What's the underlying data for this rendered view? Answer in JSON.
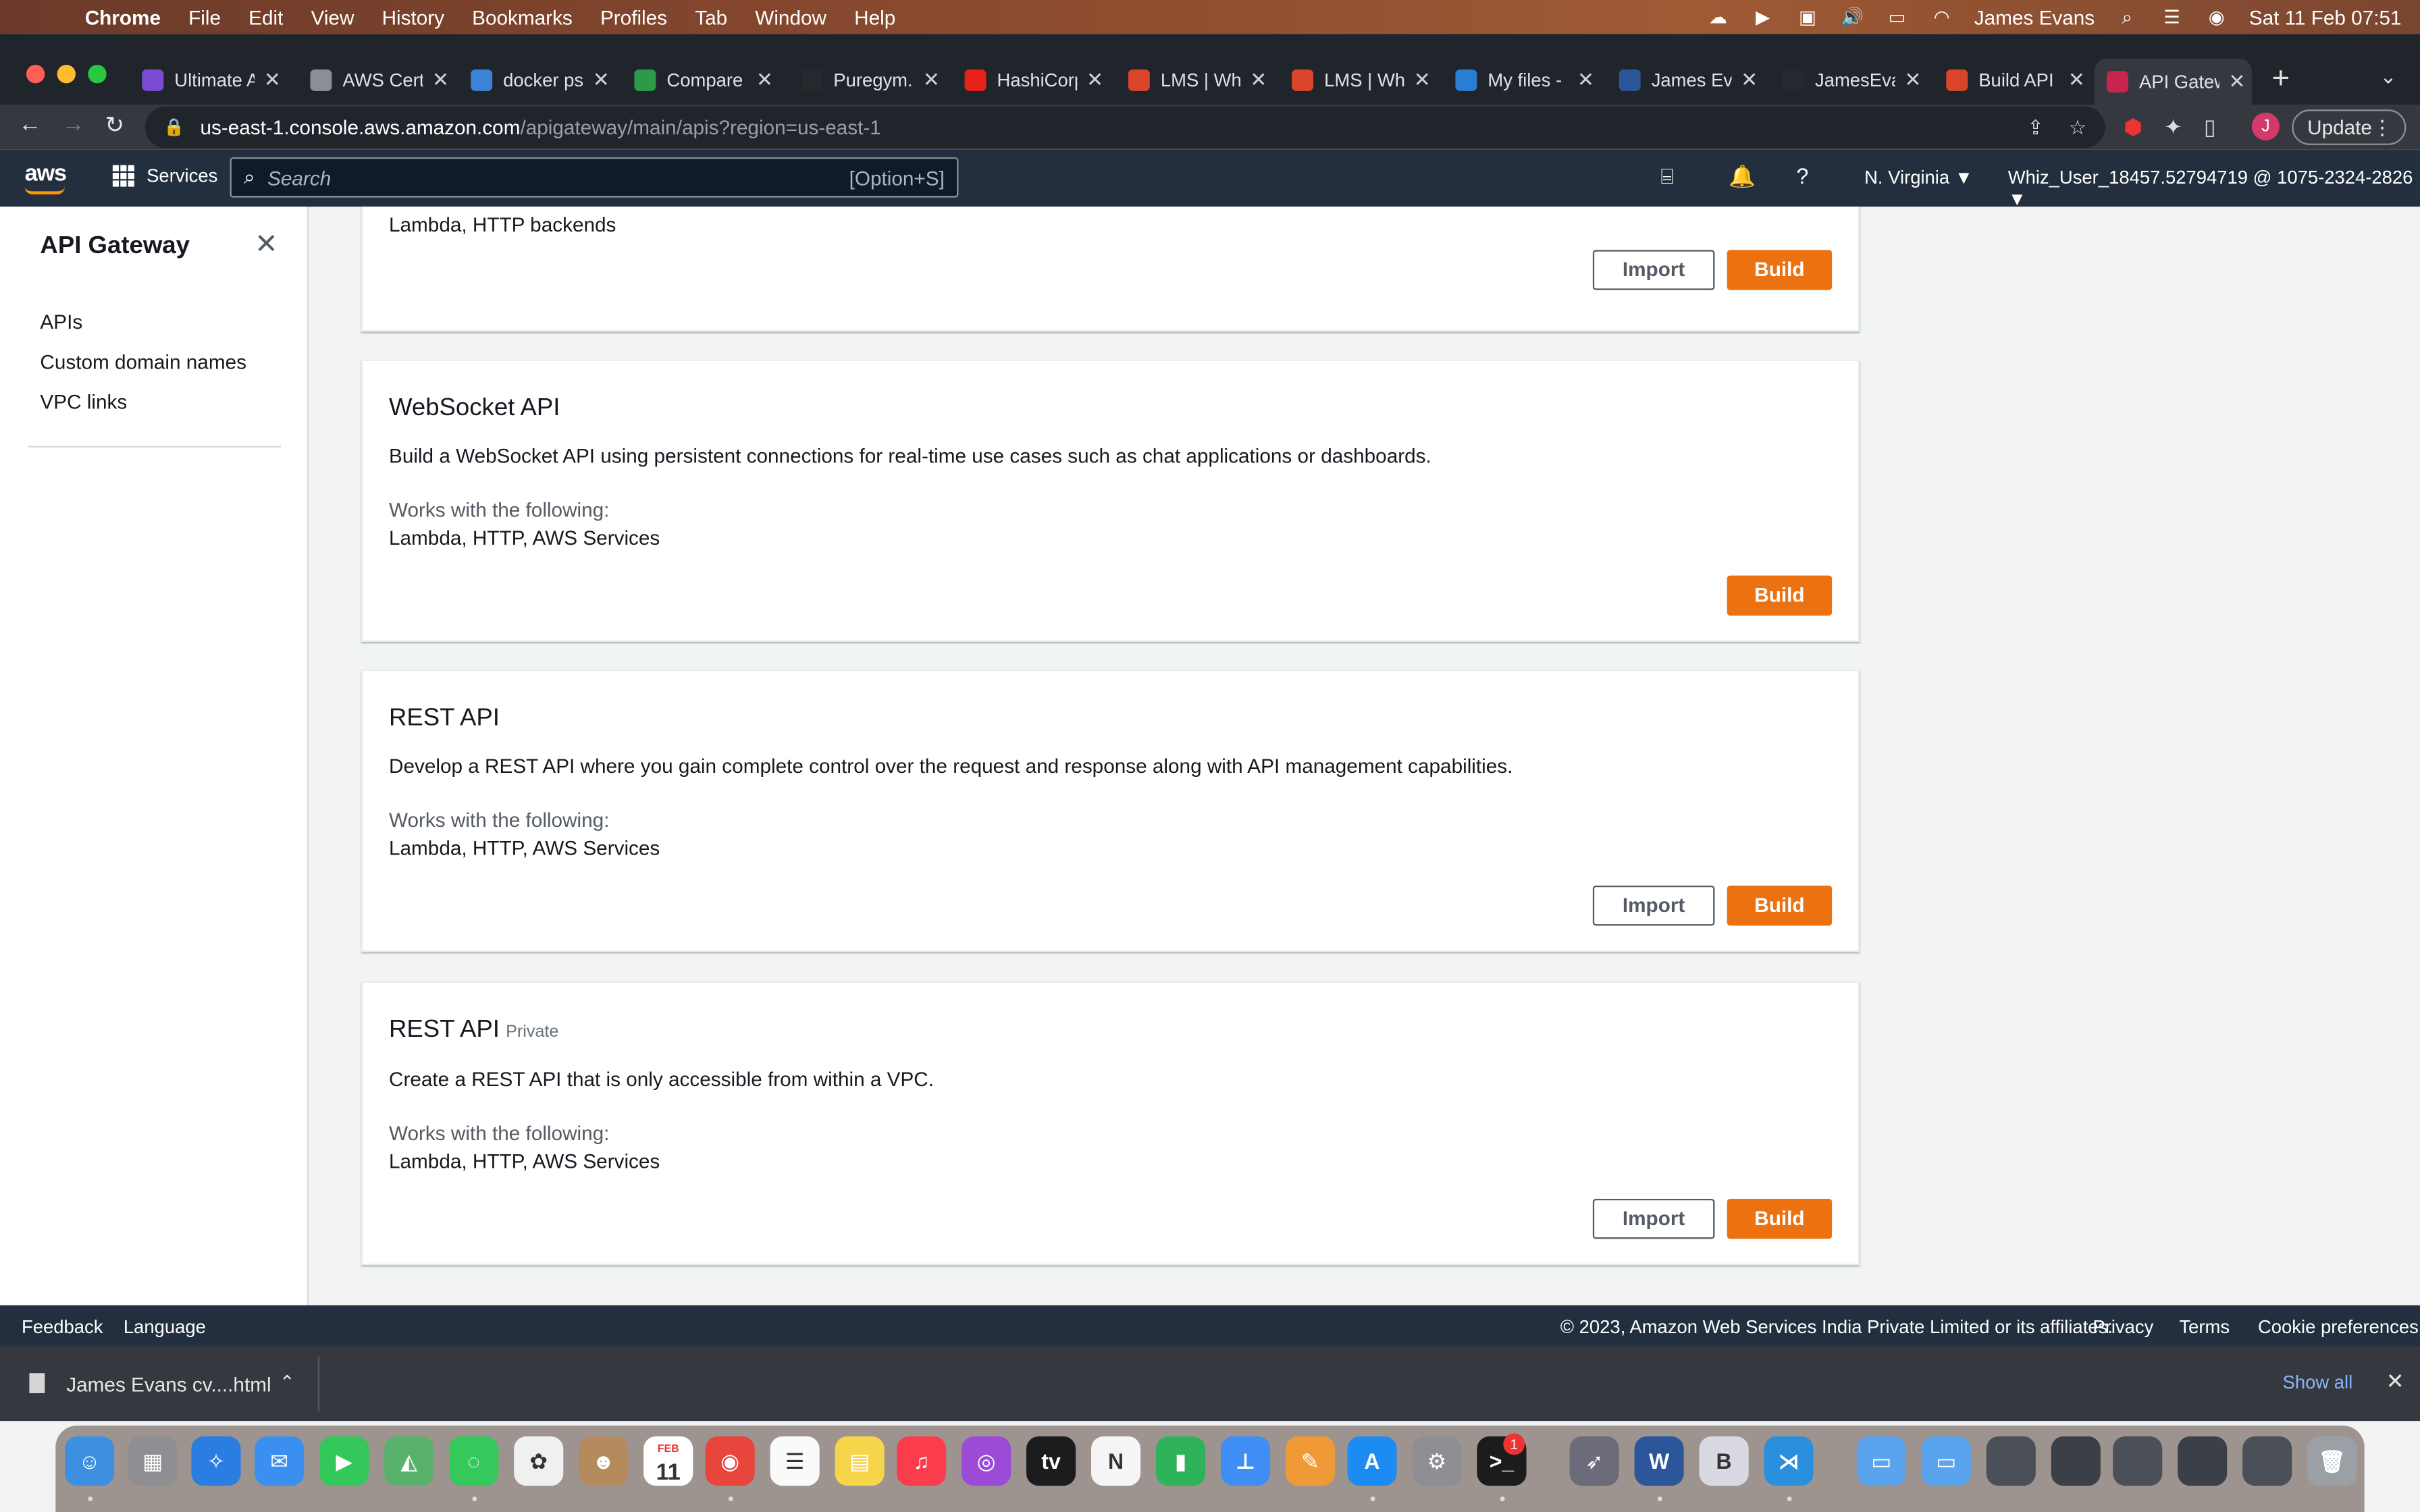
{
  "menubar": {
    "app": "Chrome",
    "items": [
      "File",
      "Edit",
      "View",
      "History",
      "Bookmarks",
      "Profiles",
      "Tab",
      "Window",
      "Help"
    ],
    "user": "James Evans",
    "datetime": "Sat 11 Feb  07:51"
  },
  "tabs": [
    {
      "label": "Ultimate A",
      "color": "#7b4bd1"
    },
    {
      "label": "AWS Certi",
      "color": "#8a8f96"
    },
    {
      "label": "docker ps",
      "color": "#3c82d6"
    },
    {
      "label": "Compare",
      "color": "#2d9a4a"
    },
    {
      "label": "Puregym.",
      "color": "#24292e"
    },
    {
      "label": "HashiCorp",
      "color": "#e62117"
    },
    {
      "label": "LMS | Whi",
      "color": "#d9442b"
    },
    {
      "label": "LMS | Whi",
      "color": "#d9442b"
    },
    {
      "label": "My files -",
      "color": "#2b7cd3"
    },
    {
      "label": "James Eva",
      "color": "#2b579a"
    },
    {
      "label": "JamesEva",
      "color": "#24292e"
    },
    {
      "label": "Build API",
      "color": "#d9442b"
    },
    {
      "label": "API Gatew",
      "color": "#c7254e"
    }
  ],
  "toolbar": {
    "url_host": "us-east-1.console.aws.amazon.com",
    "url_path": "/apigateway/main/apis?region=us-east-1",
    "avatar_letter": "J",
    "update_label": "Update"
  },
  "aws": {
    "logo": "aws",
    "services_label": "Services",
    "search_placeholder": "Search",
    "search_shortcut": "[Option+S]",
    "region": "N. Virginia ▼",
    "account": "Whiz_User_18457.52794719 @ 1075-2324-2826 ▼"
  },
  "sidebar": {
    "title": "API Gateway",
    "items": [
      "APIs",
      "Custom domain names",
      "VPC links"
    ]
  },
  "cards": [
    {
      "title": "",
      "tag": "",
      "description": "",
      "works_label": "",
      "backends": "Lambda, HTTP backends",
      "import_label": "Import",
      "build_label": "Build"
    },
    {
      "title": "WebSocket API",
      "tag": "",
      "description": "Build a WebSocket API using persistent connections for real-time use cases such as chat applications or dashboards.",
      "works_label": "Works with the following:",
      "backends": "Lambda, HTTP, AWS Services",
      "import_label": "",
      "build_label": "Build"
    },
    {
      "title": "REST API",
      "tag": "",
      "description": "Develop a REST API where you gain complete control over the request and response along with API management capabilities.",
      "works_label": "Works with the following:",
      "backends": "Lambda, HTTP, AWS Services",
      "import_label": "Import",
      "build_label": "Build"
    },
    {
      "title": "REST API",
      "tag": "Private",
      "description": "Create a REST API that is only accessible from within a VPC.",
      "works_label": "Works with the following:",
      "backends": "Lambda, HTTP, AWS Services",
      "import_label": "Import",
      "build_label": "Build"
    }
  ],
  "footer": {
    "feedback": "Feedback",
    "language": "Language",
    "copyright": "© 2023, Amazon Web Services India Private Limited or its affiliates.",
    "privacy": "Privacy",
    "terms": "Terms",
    "cookies": "Cookie preferences"
  },
  "download": {
    "filename": "James Evans cv....html",
    "show_all": "Show all"
  },
  "dock": {
    "calendar_month": "FEB",
    "calendar_day": "11",
    "settings_badge": "1",
    "apps": [
      {
        "name": "finder-icon",
        "color": "#3d8fe0",
        "glyph": "☺"
      },
      {
        "name": "launchpad-icon",
        "color": "#8e8e93",
        "glyph": "▦"
      },
      {
        "name": "safari-icon",
        "color": "#2a7de1",
        "glyph": "✧"
      },
      {
        "name": "mail-icon",
        "color": "#3a8ff0",
        "glyph": "✉"
      },
      {
        "name": "facetime-icon",
        "color": "#34c759",
        "glyph": "▶"
      },
      {
        "name": "maps-icon",
        "color": "#58b26b",
        "glyph": "◭"
      },
      {
        "name": "messages-icon",
        "color": "#35c85a",
        "glyph": "◌"
      },
      {
        "name": "photos-icon",
        "color": "#f0f0f0",
        "glyph": "✿"
      },
      {
        "name": "contacts-icon",
        "color": "#b58a5c",
        "glyph": "☻"
      },
      {
        "name": "calendar-icon",
        "color": "#ffffff",
        "glyph": "11"
      },
      {
        "name": "chrome-icon",
        "color": "#e8453c",
        "glyph": "◉"
      },
      {
        "name": "reminders-icon",
        "color": "#fafafa",
        "glyph": "☰"
      },
      {
        "name": "notes-icon",
        "color": "#f7d54a",
        "glyph": "▤"
      },
      {
        "name": "music-icon",
        "color": "#fa3c4c",
        "glyph": "♫"
      },
      {
        "name": "podcasts-icon",
        "color": "#9b4bd6",
        "glyph": "◎"
      },
      {
        "name": "tv-icon",
        "color": "#1c1c1e",
        "glyph": "tv"
      },
      {
        "name": "news-icon",
        "color": "#f5f5f5",
        "glyph": "N"
      },
      {
        "name": "numbers-icon",
        "color": "#2fb35a",
        "glyph": "▮"
      },
      {
        "name": "keynote-icon",
        "color": "#3f8ef5",
        "glyph": "⊥"
      },
      {
        "name": "pages-icon",
        "color": "#f09a37",
        "glyph": "✎"
      },
      {
        "name": "appstore-icon",
        "color": "#1d8cf2",
        "glyph": "A"
      },
      {
        "name": "system-settings-icon",
        "color": "#8e8e93",
        "glyph": "⚙"
      },
      {
        "name": "terminal-icon",
        "color": "#1c1c1c",
        "glyph": ">_"
      },
      {
        "name": "rocket-icon",
        "color": "#6b6b7a",
        "glyph": "➶"
      },
      {
        "name": "word-icon",
        "color": "#2b579a",
        "glyph": "W"
      },
      {
        "name": "bbedit-icon",
        "color": "#d9d9e3",
        "glyph": "B"
      },
      {
        "name": "vscode-icon",
        "color": "#2a8fdc",
        "glyph": "⋊"
      },
      {
        "name": "downloads-folder-icon",
        "color": "#5aa4ee",
        "glyph": "▭"
      },
      {
        "name": "apps-folder-icon",
        "color": "#5aa4ee",
        "glyph": "▭"
      },
      {
        "name": "window-thumb-1-icon",
        "color": "#4a4f58",
        "glyph": ""
      },
      {
        "name": "window-thumb-2-icon",
        "color": "#3a3f48",
        "glyph": ""
      },
      {
        "name": "window-thumb-3-icon",
        "color": "#4a4f58",
        "glyph": ""
      },
      {
        "name": "window-thumb-4-icon",
        "color": "#3a3f48",
        "glyph": ""
      },
      {
        "name": "window-thumb-5-icon",
        "color": "#4a4f58",
        "glyph": ""
      },
      {
        "name": "trash-icon",
        "color": "#9aa0a6",
        "glyph": "🗑"
      }
    ]
  },
  "colors": {
    "aws_header": "#232f3e",
    "aws_orange": "#ec7211",
    "chrome_dark": "#20242b"
  }
}
